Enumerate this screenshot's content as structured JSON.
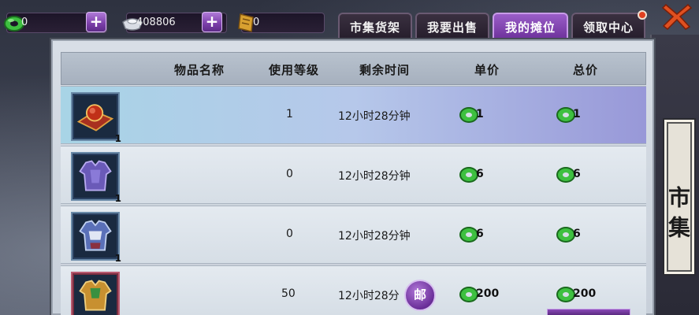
{
  "resources": {
    "jade": {
      "value": "0",
      "icon": "jade-coin-icon"
    },
    "silver": {
      "value": "408806",
      "icon": "silver-ingot-icon"
    },
    "voucher": {
      "value": "0",
      "icon": "voucher-ticket-icon"
    },
    "plus_label": "+"
  },
  "tabs": [
    {
      "label": "市集货架",
      "active": false
    },
    {
      "label": "我要出售",
      "active": false
    },
    {
      "label": "我的摊位",
      "active": true
    },
    {
      "label": "领取中心",
      "active": false,
      "badge": true
    }
  ],
  "side_title": "市集",
  "table": {
    "headers": [
      "物品名称",
      "使用等级",
      "剩余时间",
      "单价",
      "总价"
    ],
    "rows": [
      {
        "icon": "red-carpet-item-icon",
        "qty": "1",
        "level": "1",
        "time": "12小时28分钟",
        "unit_price": "1",
        "total_price": "1",
        "selected": true
      },
      {
        "icon": "purple-armor-item-icon",
        "qty": "1",
        "level": "0",
        "time": "12小时28分钟",
        "unit_price": "6",
        "total_price": "6",
        "selected": false
      },
      {
        "icon": "blue-armor-item-icon",
        "qty": "1",
        "level": "0",
        "time": "12小时28分钟",
        "unit_price": "6",
        "total_price": "6",
        "selected": false
      },
      {
        "icon": "gold-armor-item-icon",
        "qty": "",
        "level": "50",
        "time": "12小时28分",
        "unit_price": "200",
        "total_price": "200",
        "selected": false
      }
    ]
  },
  "mail_button_label": "邮",
  "colors": {
    "accent": "#7a3ea8",
    "selected_row": "#a8d4e6",
    "jade": "#3ec040"
  }
}
